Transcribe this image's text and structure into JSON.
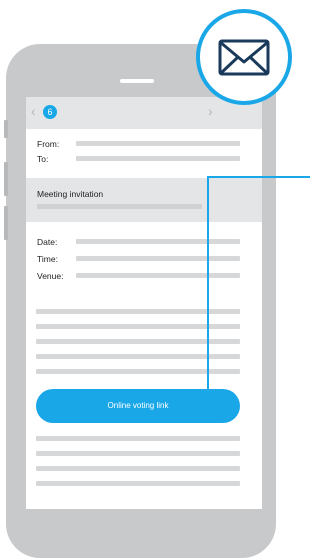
{
  "colors": {
    "accent": "#1aa7e8",
    "phone_body": "#c8c9cb",
    "screen_band": "#e4e5e6",
    "placeholder_bar": "#d6d7d9"
  },
  "icons": {
    "back": "chevron-left-icon",
    "forward": "chevron-right-icon",
    "mail": "envelope-icon"
  },
  "topbar": {
    "badge_count": "6"
  },
  "header": {
    "from_label": "From:",
    "to_label": "To:"
  },
  "subject": {
    "title": "Meeting invitation"
  },
  "details": {
    "date_label": "Date:",
    "time_label": "Time:",
    "venue_label": "Venue:"
  },
  "action": {
    "voting_button_label": "Online voting link"
  }
}
